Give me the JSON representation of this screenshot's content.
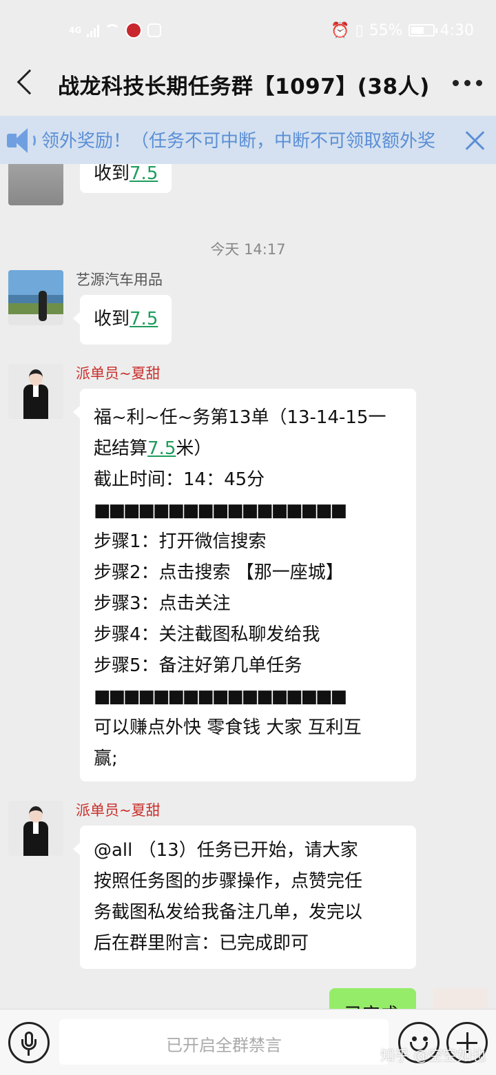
{
  "status_bar": {
    "network": "4G",
    "battery_percent": "55%",
    "time": "4:30"
  },
  "header": {
    "title": "战龙科技长期任务群【1097】(38人)"
  },
  "notice": {
    "text": "领外奖励！（任务不可中断，中断不可领取额外奖"
  },
  "chat": {
    "prev_message": {
      "prefix": "收到",
      "link": "7.5"
    },
    "timestamp": "今天 14:17",
    "messages": [
      {
        "sender": "艺源汽车用品",
        "prefix": "收到",
        "link": "7.5"
      },
      {
        "sender": "派单员~夏甜",
        "line1": "福~利~任~务第13单（13-14-15一",
        "line2_prefix": "起结算",
        "line2_link": "7.5",
        "line2_suffix": "米）",
        "line3": "截止时间：14：45分",
        "line4": "■■■■■■■■■■■■■■■■■",
        "line5": "步骤1：打开微信搜索",
        "line6": "步骤2：点击搜索 【那一座城】",
        "line7": "步骤3：点击关注",
        "line8": "步骤4：关注截图私聊发给我",
        "line9": "步骤5：备注好第几单任务",
        "line10": "■■■■■■■■■■■■■■■■■",
        "line11": "可以赚点外快 零食钱 大家 互利互",
        "line12": "赢;"
      },
      {
        "sender": "派单员~夏甜",
        "line1": "@all （13）任务已开始，请大家",
        "line2": "按照任务图的步骤操作，点赞完任",
        "line3": "务截图私发给我备注几单，发完以",
        "line4": "后在群里附言：已完成即可"
      }
    ],
    "own_message_partial": "已完成"
  },
  "input": {
    "placeholder": "已开启全群禁言"
  },
  "watermark": "知乎 @空空如也"
}
